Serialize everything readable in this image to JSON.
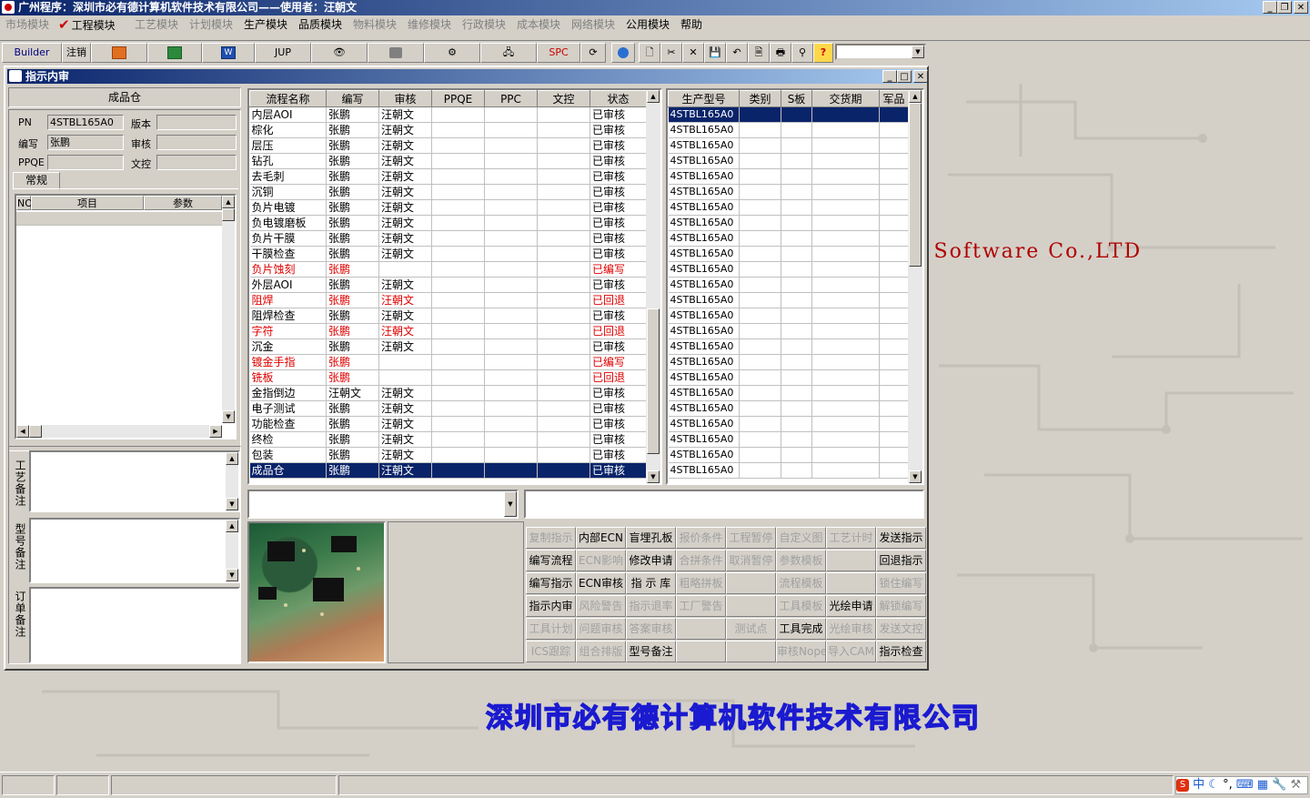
{
  "titlebar": {
    "title": "广州程序：深圳市必有德计算机软件技术有限公司——使用者：汪朝文"
  },
  "menu": [
    {
      "label": "市场模块",
      "enabled": false
    },
    {
      "label": "工程模块",
      "enabled": true,
      "checked": true
    },
    {
      "label": "工艺模块",
      "enabled": false
    },
    {
      "label": "计划模块",
      "enabled": false
    },
    {
      "label": "生产模块",
      "enabled": true
    },
    {
      "label": "品质模块",
      "enabled": true
    },
    {
      "label": "物料模块",
      "enabled": false
    },
    {
      "label": "维修模块",
      "enabled": false
    },
    {
      "label": "行政模块",
      "enabled": false
    },
    {
      "label": "成本模块",
      "enabled": false
    },
    {
      "label": "网络模块",
      "enabled": false
    },
    {
      "label": "公用模块",
      "enabled": true
    },
    {
      "label": "帮助",
      "enabled": true
    }
  ],
  "toolbar": {
    "builder": "Builder",
    "logout": "注销",
    "jup": "JUP",
    "spc": "SPC"
  },
  "desktop": {
    "watermark_en": "er Software Co.,LTD",
    "watermark_cn": "深圳市必有德计算机软件技术有限公司"
  },
  "window": {
    "title": "指示内审",
    "left": {
      "header": "成品仓",
      "pn_label": "PN",
      "pn_value": "4STBL165A0",
      "version_label": "版本",
      "version_value": "",
      "editor_label": "编写",
      "editor_value": "张鹏",
      "reviewer_label": "审核",
      "reviewer_value": "",
      "ppqe_label": "PPQE",
      "ppqe_value": "",
      "wenkong_label": "文控",
      "wenkong_value": "",
      "tab": "常规",
      "param_cols": [
        "NO",
        "项目",
        "参数"
      ],
      "notes": [
        "工艺备注",
        "型号备注",
        "订单备注"
      ]
    },
    "process_cols": [
      "流程名称",
      "编写",
      "审核",
      "PPQE",
      "PPC",
      "文控",
      "状态"
    ],
    "process_rows": [
      {
        "name": "内层AOI",
        "editor": "张鹏",
        "reviewer": "汪朝文",
        "status": "已审核",
        "red": false
      },
      {
        "name": "棕化",
        "editor": "张鹏",
        "reviewer": "汪朝文",
        "status": "已审核",
        "red": false
      },
      {
        "name": "层压",
        "editor": "张鹏",
        "reviewer": "汪朝文",
        "status": "已审核",
        "red": false
      },
      {
        "name": "钻孔",
        "editor": "张鹏",
        "reviewer": "汪朝文",
        "status": "已审核",
        "red": false
      },
      {
        "name": "去毛刺",
        "editor": "张鹏",
        "reviewer": "汪朝文",
        "status": "已审核",
        "red": false
      },
      {
        "name": "沉铜",
        "editor": "张鹏",
        "reviewer": "汪朝文",
        "status": "已审核",
        "red": false
      },
      {
        "name": "负片电镀",
        "editor": "张鹏",
        "reviewer": "汪朝文",
        "status": "已审核",
        "red": false
      },
      {
        "name": "负电镀磨板",
        "editor": "张鹏",
        "reviewer": "汪朝文",
        "status": "已审核",
        "red": false
      },
      {
        "name": "负片干膜",
        "editor": "张鹏",
        "reviewer": "汪朝文",
        "status": "已审核",
        "red": false
      },
      {
        "name": "干膜检查",
        "editor": "张鹏",
        "reviewer": "汪朝文",
        "status": "已审核",
        "red": false
      },
      {
        "name": "负片蚀刻",
        "editor": "张鹏",
        "reviewer": "",
        "status": "已编写",
        "red": true
      },
      {
        "name": "外层AOI",
        "editor": "张鹏",
        "reviewer": "汪朝文",
        "status": "已审核",
        "red": false
      },
      {
        "name": "阻焊",
        "editor": "张鹏",
        "reviewer": "汪朝文",
        "status": "已回退",
        "red": true
      },
      {
        "name": "阻焊检查",
        "editor": "张鹏",
        "reviewer": "汪朝文",
        "status": "已审核",
        "red": false
      },
      {
        "name": "字符",
        "editor": "张鹏",
        "reviewer": "汪朝文",
        "status": "已回退",
        "red": true
      },
      {
        "name": "沉金",
        "editor": "张鹏",
        "reviewer": "汪朝文",
        "status": "已审核",
        "red": false
      },
      {
        "name": "镀金手指",
        "editor": "张鹏",
        "reviewer": "",
        "status": "已编写",
        "red": true
      },
      {
        "name": "铣板",
        "editor": "张鹏",
        "reviewer": "",
        "status": "已回退",
        "red": true
      },
      {
        "name": "金指倒边",
        "editor": "汪朝文",
        "reviewer": "汪朝文",
        "status": "已审核",
        "red": false
      },
      {
        "name": "电子测试",
        "editor": "张鹏",
        "reviewer": "汪朝文",
        "status": "已审核",
        "red": false
      },
      {
        "name": "功能检查",
        "editor": "张鹏",
        "reviewer": "汪朝文",
        "status": "已审核",
        "red": false
      },
      {
        "name": "终检",
        "editor": "张鹏",
        "reviewer": "汪朝文",
        "status": "已审核",
        "red": false
      },
      {
        "name": "包装",
        "editor": "张鹏",
        "reviewer": "汪朝文",
        "status": "已审核",
        "red": false
      },
      {
        "name": "成品仓",
        "editor": "张鹏",
        "reviewer": "汪朝文",
        "status": "已审核",
        "red": false,
        "selected": true
      }
    ],
    "model_cols": [
      "生产型号",
      "类别",
      "S板",
      "交货期",
      "军品"
    ],
    "model_value": "4STBL165A0",
    "buttons": [
      [
        "复制指示",
        "内部ECN",
        "盲埋孔板",
        "报价条件",
        "工程暂停",
        "自定义图",
        "工艺计时",
        "发送指示"
      ],
      [
        "编写流程",
        "ECN影响",
        "修改申请",
        "合拼条件",
        "取消暂停",
        "参数模板",
        "",
        "回退指示"
      ],
      [
        "编写指示",
        "ECN审核",
        "指 示 库",
        "粗略拼板",
        "",
        "流程模板",
        "",
        "锁住编写"
      ],
      [
        "指示内审",
        "风险警告",
        "指示退率",
        "工厂警告",
        "",
        "工具模板",
        "光绘申请",
        "解锁编写"
      ],
      [
        "工具计划",
        "问题审核",
        "答案审核",
        "",
        "测试点",
        "工具完成",
        "光绘审核",
        "发送文控"
      ],
      [
        "ICS跟踪",
        "组合排版",
        "型号备注",
        "",
        "",
        "审核Nope",
        "导入CAM",
        "指示检查"
      ]
    ],
    "buttons_enabled": [
      [
        false,
        true,
        true,
        false,
        false,
        false,
        false,
        true
      ],
      [
        true,
        false,
        true,
        false,
        false,
        false,
        true,
        true
      ],
      [
        true,
        true,
        true,
        false,
        true,
        false,
        true,
        false
      ],
      [
        true,
        false,
        false,
        false,
        true,
        false,
        true,
        false
      ],
      [
        false,
        false,
        false,
        true,
        false,
        true,
        false,
        false
      ],
      [
        false,
        false,
        true,
        true,
        true,
        false,
        false,
        true
      ]
    ]
  },
  "tray": {
    "ime": "中"
  }
}
